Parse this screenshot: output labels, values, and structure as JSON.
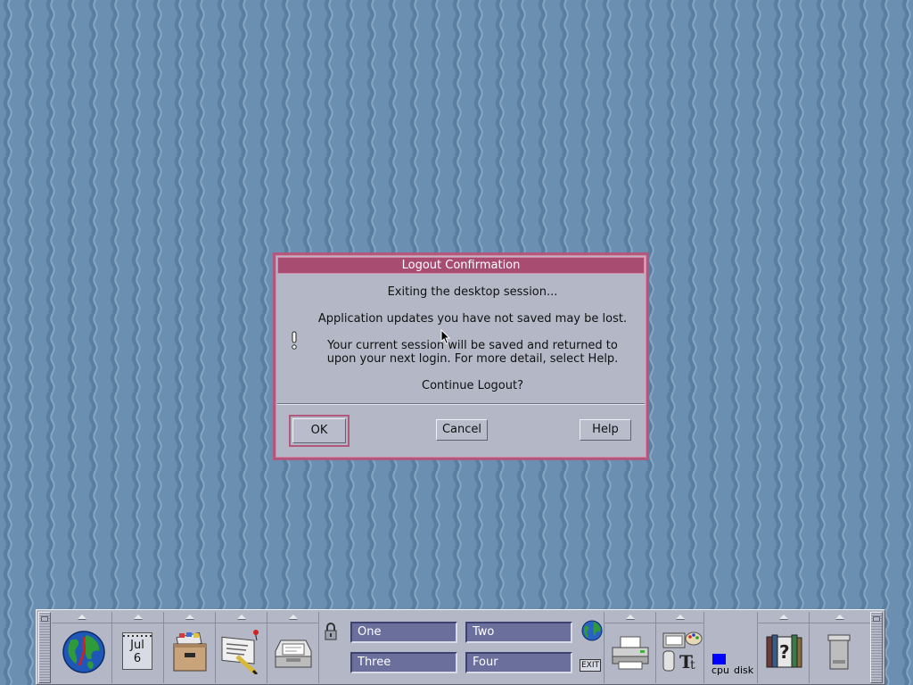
{
  "dialog": {
    "title": "Logout Confirmation",
    "line1": "Exiting the desktop session...",
    "line2": "Application updates you have not saved may be lost.",
    "line3": "Your current session will be saved and returned to",
    "line4": "upon your next login.  For more detail, select Help.",
    "line5": "Continue Logout?",
    "ok_label": "OK",
    "cancel_label": "Cancel",
    "help_label": "Help"
  },
  "panel": {
    "calendar_month": "Jul",
    "calendar_day": "6",
    "workspaces": [
      "One",
      "Two",
      "Three",
      "Four"
    ],
    "exit_label": "EXIT",
    "cpu_label": "cpu",
    "disk_label": "disk"
  },
  "colors": {
    "desktop_bg": "#6b8fb0",
    "dialog_bg": "#b3b7c6",
    "dialog_title": "#a84c72",
    "workspace_button": "#6a6f9c",
    "cpu_indicator": "#0000ff"
  }
}
